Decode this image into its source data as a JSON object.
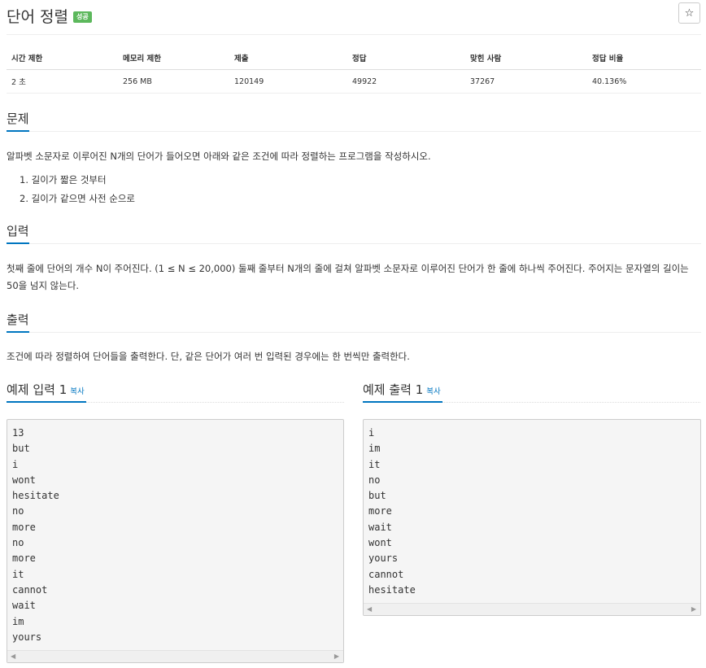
{
  "problem": {
    "title": "단어 정렬",
    "badge": "성공",
    "star_icon": "☆"
  },
  "stats": {
    "headers": [
      "시간 제한",
      "메모리 제한",
      "제출",
      "정답",
      "맞힌 사람",
      "정답 비율"
    ],
    "values": [
      "2 초",
      "256 MB",
      "120149",
      "49922",
      "37267",
      "40.136%"
    ]
  },
  "description": {
    "heading": "문제",
    "text": "알파벳 소문자로 이루어진 N개의 단어가 들어오면 아래와 같은 조건에 따라 정렬하는 프로그램을 작성하시오.",
    "items": [
      "1. 길이가 짧은 것부터",
      "2. 길이가 같으면 사전 순으로"
    ]
  },
  "input": {
    "heading": "입력",
    "text": "첫째 줄에 단어의 개수 N이 주어진다. (1 ≤ N ≤ 20,000) 둘째 줄부터 N개의 줄에 걸쳐 알파벳 소문자로 이루어진 단어가 한 줄에 하나씩 주어진다. 주어지는 문자열의 길이는 50을 넘지 않는다."
  },
  "output": {
    "heading": "출력",
    "text": "조건에 따라 정렬하여 단어들을 출력한다. 단, 같은 단어가 여러 번 입력된 경우에는 한 번씩만 출력한다."
  },
  "sample_input": {
    "heading": "예제 입력 1",
    "copy_label": "복사",
    "lines": [
      "13",
      "but",
      "i",
      "wont",
      "hesitate",
      "no",
      "more",
      "no",
      "more",
      "it",
      "cannot",
      "wait",
      "im",
      "yours"
    ]
  },
  "sample_output": {
    "heading": "예제 출력 1",
    "copy_label": "복사",
    "lines": [
      "i",
      "im",
      "it",
      "no",
      "but",
      "more",
      "wait",
      "wont",
      "yours",
      "cannot",
      "hesitate"
    ]
  },
  "scroll": {
    "left_arrow": "◀",
    "right_arrow": "▶"
  },
  "colors": {
    "accent": "#0076c0",
    "badge": "#5cb85c"
  }
}
